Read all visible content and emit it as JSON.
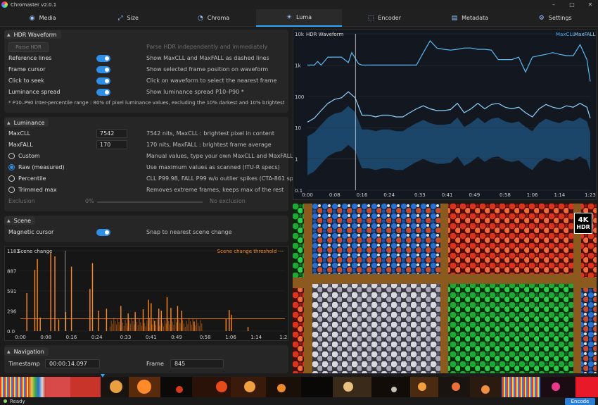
{
  "app": {
    "title": "Chromaster v2.0.1"
  },
  "window_controls": {
    "minimize": "–",
    "maximize": "□",
    "close": "✕"
  },
  "tabs": [
    {
      "label": "Media",
      "icon": "media-icon"
    },
    {
      "label": "Size",
      "icon": "size-icon"
    },
    {
      "label": "Chroma",
      "icon": "chroma-icon"
    },
    {
      "label": "Luma",
      "icon": "luma-icon",
      "active": true
    },
    {
      "label": "Encoder",
      "icon": "encoder-icon"
    },
    {
      "label": "Metadata",
      "icon": "metadata-icon"
    },
    {
      "label": "Settings",
      "icon": "settings-icon"
    }
  ],
  "hdr_waveform": {
    "title": "HDR Waveform",
    "parse_button": "Parse HDR",
    "parse_desc": "Parse HDR independently and immediately",
    "options": [
      {
        "label": "Reference lines",
        "desc": "Show MaxCLL and MaxFALL as dashed lines",
        "on": true
      },
      {
        "label": "Frame cursor",
        "desc": "Show selected frame position on waveform",
        "on": true
      },
      {
        "label": "Click to seek",
        "desc": "Click on waveform to select the nearest frame",
        "on": true
      },
      {
        "label": "Luminance spread",
        "desc": "Show luminance spread P10–P90 *",
        "on": true
      }
    ],
    "note": "* P10–P90 inter-percentile range : 80% of pixel luminance values, excluding the 10% darkest and 10% brightest"
  },
  "luminance": {
    "title": "Luminance",
    "maxcll_label": "MaxCLL",
    "maxcll_value": "7542",
    "maxcll_desc": "7542 nits, MaxCLL : brightest pixel in content",
    "maxfall_label": "MaxFALL",
    "maxfall_value": "170",
    "maxfall_desc": "170 nits, MaxFALL : brightest frame average",
    "modes": [
      {
        "label": "Custom",
        "desc": "Manual values, type your own MaxCLL and MaxFALL",
        "selected": false
      },
      {
        "label": "Raw (measured)",
        "desc": "Use maximum values as scanned (ITU-R specs)",
        "selected": true
      },
      {
        "label": "Percentile",
        "desc": "CLL P99.98, FALL P99 w/o outlier spikes (CTA-861 specs)",
        "selected": false
      },
      {
        "label": "Trimmed max",
        "desc": "Removes extreme frames, keeps max of the rest",
        "selected": false
      }
    ],
    "exclusion_label": "Exclusion",
    "exclusion_value": "0%",
    "exclusion_desc": "No exclusion"
  },
  "scene": {
    "title": "Scene",
    "magnetic_label": "Magnetic cursor",
    "magnetic_desc": "Snap to nearest scene change",
    "magnetic_on": true
  },
  "navigation": {
    "title": "Navigation",
    "timestamp_label": "Timestamp",
    "timestamp_value": "00:00:14.097",
    "frame_label": "Frame",
    "frame_value": "845"
  },
  "colors": {
    "accent": "#2e8fe6",
    "waveform": "#5bb8f0",
    "scene": "#ff8a1e",
    "maxcll": "#4aa8f0"
  },
  "chart_data": [
    {
      "type": "line",
      "title": "HDR Waveform",
      "legend": [
        "MaxCLL",
        "MaxFALL"
      ],
      "legend_placement": "top-right",
      "yscale": "log",
      "yticks": [
        "10k",
        "1k",
        "100",
        "10",
        "1",
        "0.1"
      ],
      "ylim": [
        0.1,
        10000
      ],
      "xticks": [
        "0:00",
        "0:08",
        "0:16",
        "0:24",
        "0:33",
        "0:41",
        "0:49",
        "0:58",
        "1:06",
        "1:14",
        "1:23"
      ],
      "series": [
        {
          "name": "MaxCLL",
          "x": [
            0,
            2,
            3,
            4,
            6,
            8,
            10,
            12,
            13,
            15,
            16,
            18,
            20,
            22,
            24,
            26,
            28,
            30,
            32,
            34,
            36,
            38,
            40,
            42,
            44,
            46,
            48,
            50,
            52,
            54,
            56,
            58,
            60,
            62,
            64,
            66,
            68,
            70,
            72,
            74,
            76,
            78,
            80,
            82,
            83
          ],
          "values": [
            1000,
            1000,
            1300,
            1000,
            1800,
            1800,
            1800,
            1200,
            2500,
            1100,
            1000,
            1000,
            1000,
            1000,
            1000,
            1000,
            1000,
            1000,
            1000,
            2500,
            6000,
            3500,
            3200,
            3000,
            3200,
            3500,
            3500,
            3200,
            3200,
            3000,
            1500,
            1500,
            1500,
            1800,
            600,
            1800,
            2000,
            2200,
            2500,
            2200,
            2000,
            2000,
            4500,
            1500,
            300
          ]
        },
        {
          "name": "MaxFALL",
          "x": [
            0,
            2,
            4,
            6,
            8,
            10,
            12,
            14,
            16,
            18,
            20,
            22,
            24,
            26,
            28,
            30,
            32,
            34,
            36,
            38,
            40,
            42,
            44,
            46,
            48,
            50,
            52,
            54,
            56,
            58,
            60,
            62,
            64,
            66,
            68,
            70,
            72,
            74,
            76,
            78,
            80,
            82,
            83
          ],
          "values": [
            15,
            20,
            35,
            60,
            80,
            90,
            140,
            90,
            25,
            25,
            22,
            25,
            25,
            22,
            22,
            30,
            40,
            50,
            40,
            35,
            35,
            38,
            60,
            30,
            40,
            60,
            40,
            55,
            60,
            45,
            40,
            45,
            30,
            22,
            40,
            55,
            45,
            40,
            50,
            45,
            60,
            45,
            20
          ]
        }
      ]
    },
    {
      "type": "bar",
      "title": "Scene change",
      "legend": [
        "Scene change threshold"
      ],
      "yticks": [
        1183,
        887,
        591,
        296,
        0
      ],
      "ylim": [
        0,
        1183
      ],
      "threshold": 180,
      "xticks": [
        "0:00",
        "0:08",
        "0:16",
        "0:24",
        "0:33",
        "0:41",
        "0:49",
        "0:58",
        "1:06",
        "1:14",
        "1:23"
      ],
      "x": [
        2.0,
        4.5,
        5.3,
        6.2,
        9.5,
        10.8,
        12.0,
        14.2,
        16.0,
        21.8,
        22.6,
        24.5,
        27.0,
        31.5,
        33.8,
        36.0,
        38.5,
        40.2,
        41.0,
        42.1,
        43.4,
        44.2,
        46.0,
        47.2,
        49.3,
        50.6,
        54.5,
        64.5,
        65.5,
        66.2,
        71.4
      ],
      "values": [
        560,
        900,
        1060,
        200,
        1150,
        1100,
        170,
        280,
        950,
        620,
        1000,
        300,
        330,
        370,
        260,
        280,
        320,
        460,
        410,
        150,
        330,
        300,
        500,
        340,
        370,
        300,
        140,
        180,
        310,
        240,
        60
      ]
    }
  ],
  "preview": {
    "badge_top": "4K",
    "badge_bottom": "HDR"
  },
  "status": {
    "text": "Ready",
    "encode_button": "Encode"
  }
}
